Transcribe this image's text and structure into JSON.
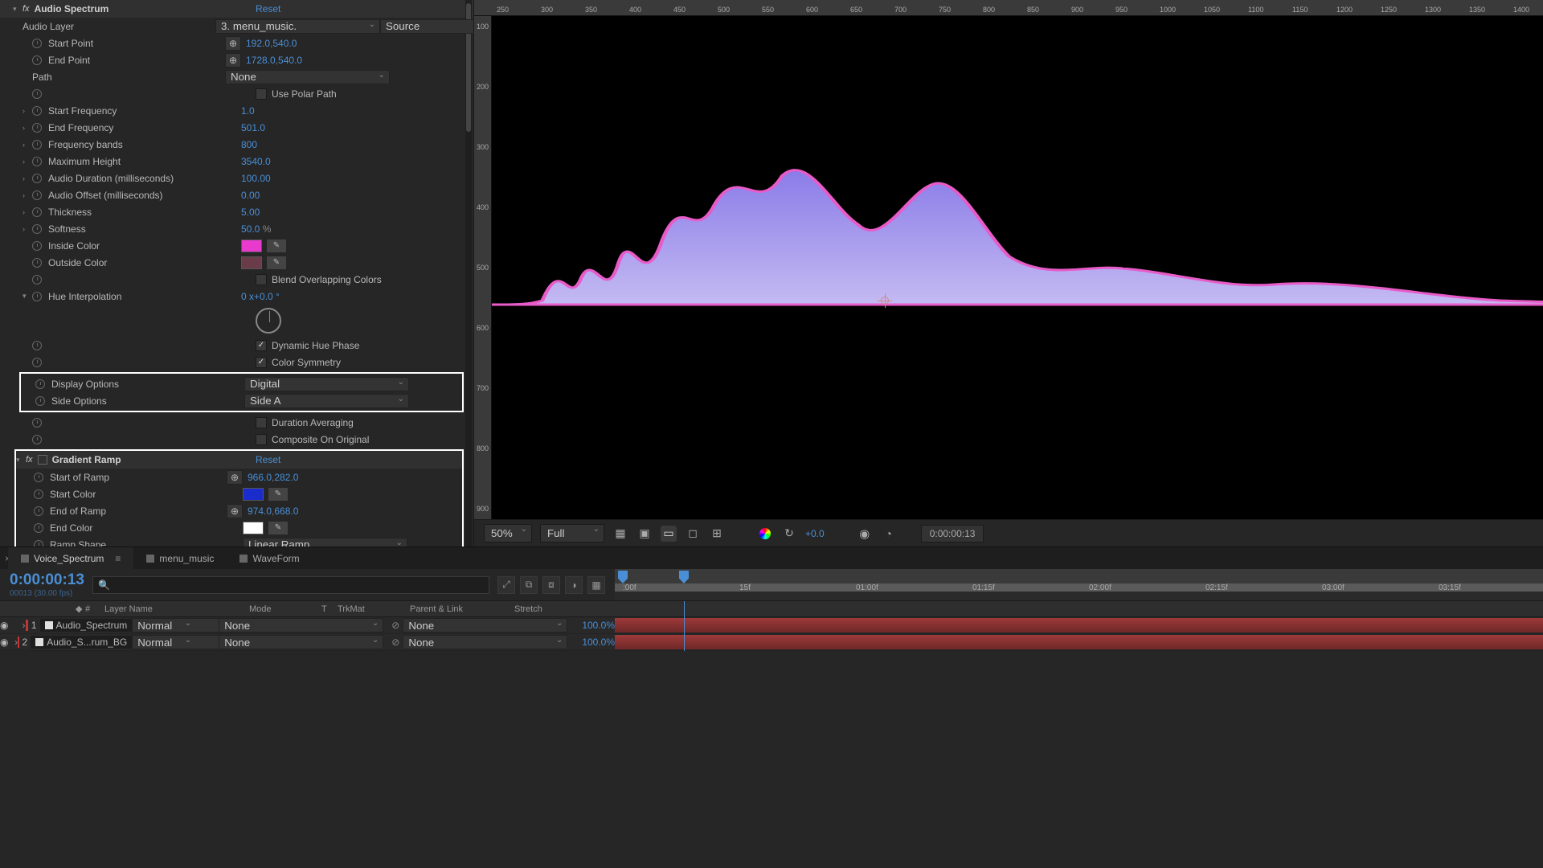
{
  "effects": {
    "audioSpectrum": {
      "name": "Audio Spectrum",
      "reset": "Reset",
      "audioLayer": {
        "label": "Audio Layer",
        "value": "3. menu_music.",
        "source": "Source"
      },
      "startPoint": {
        "label": "Start Point",
        "x": "192.0",
        "y": "540.0"
      },
      "endPoint": {
        "label": "End Point",
        "x": "1728.0",
        "y": "540.0"
      },
      "path": {
        "label": "Path",
        "value": "None"
      },
      "usePolarPath": {
        "label": "Use Polar Path",
        "checked": false
      },
      "startFreq": {
        "label": "Start Frequency",
        "value": "1.0"
      },
      "endFreq": {
        "label": "End Frequency",
        "value": "501.0"
      },
      "freqBands": {
        "label": "Frequency bands",
        "value": "800"
      },
      "maxHeight": {
        "label": "Maximum Height",
        "value": "3540.0"
      },
      "audioDuration": {
        "label": "Audio Duration (milliseconds)",
        "value": "100.00"
      },
      "audioOffset": {
        "label": "Audio Offset (milliseconds)",
        "value": "0.00"
      },
      "thickness": {
        "label": "Thickness",
        "value": "5.00"
      },
      "softness": {
        "label": "Softness",
        "value": "50.0"
      },
      "insideColor": {
        "label": "Inside Color",
        "hex": "#e83bcd"
      },
      "outsideColor": {
        "label": "Outside Color",
        "hex": "#6a3c4a"
      },
      "blendOverlap": {
        "label": "Blend Overlapping Colors",
        "checked": false
      },
      "hueInterp": {
        "label": "Hue Interpolation",
        "value": "0 x+0.0 °"
      },
      "dynamicHue": {
        "label": "Dynamic Hue Phase",
        "checked": true
      },
      "colorSymmetry": {
        "label": "Color Symmetry",
        "checked": true
      },
      "displayOptions": {
        "label": "Display Options",
        "value": "Digital"
      },
      "sideOptions": {
        "label": "Side Options",
        "value": "Side A"
      },
      "durationAvg": {
        "label": "Duration Averaging",
        "checked": false
      },
      "compositeOrig": {
        "label": "Composite On Original",
        "checked": false
      }
    },
    "gradientRamp": {
      "name": "Gradient Ramp",
      "reset": "Reset",
      "startRamp": {
        "label": "Start of Ramp",
        "x": "966.0",
        "y": "282.0"
      },
      "startColor": {
        "label": "Start Color",
        "hex": "#1a2ccc"
      },
      "endRamp": {
        "label": "End of Ramp",
        "x": "974.0",
        "y": "668.0"
      },
      "endColor": {
        "label": "End Color",
        "hex": "#ffffff"
      },
      "rampShape": {
        "label": "Ramp Shape",
        "value": "Linear Ramp"
      }
    }
  },
  "rulerTop": [
    "250",
    "300",
    "350",
    "400",
    "450",
    "500",
    "550",
    "600",
    "650",
    "700",
    "750",
    "800",
    "850",
    "900",
    "950",
    "1000",
    "1050",
    "1100",
    "1150",
    "1200",
    "1250",
    "1300",
    "1350",
    "1400"
  ],
  "rulerLeft": [
    "100",
    "200",
    "300",
    "400",
    "500",
    "600",
    "700",
    "800",
    "900"
  ],
  "viewerControls": {
    "zoom": "50%",
    "resolution": "Full",
    "exposure": "+0.0",
    "timecode": "0:00:00:13"
  },
  "tabs": {
    "items": [
      "Voice_Spectrum",
      "menu_music",
      "WaveForm"
    ],
    "active": 0
  },
  "timeline": {
    "timecode": "0:00:00:13",
    "fps": "00013 (30.00 fps)",
    "ticks": [
      ":00f",
      "15f",
      "01:00f",
      "01:15f",
      "02:00f",
      "02:15f",
      "03:00f",
      "03:15f"
    ],
    "cols": {
      "num": "#",
      "layerName": "Layer Name",
      "mode": "Mode",
      "t": "T",
      "trkMat": "TrkMat",
      "parentLink": "Parent & Link",
      "stretch": "Stretch"
    },
    "layers": [
      {
        "num": "1",
        "name": "Audio_Spectrum",
        "mode": "Normal",
        "trkmat": "None",
        "parent": "None",
        "stretch": "100.0%"
      },
      {
        "num": "2",
        "name": "Audio_S...rum_BG",
        "mode": "Normal",
        "trkmat": "None",
        "parent": "None",
        "stretch": "100.0%"
      }
    ]
  }
}
